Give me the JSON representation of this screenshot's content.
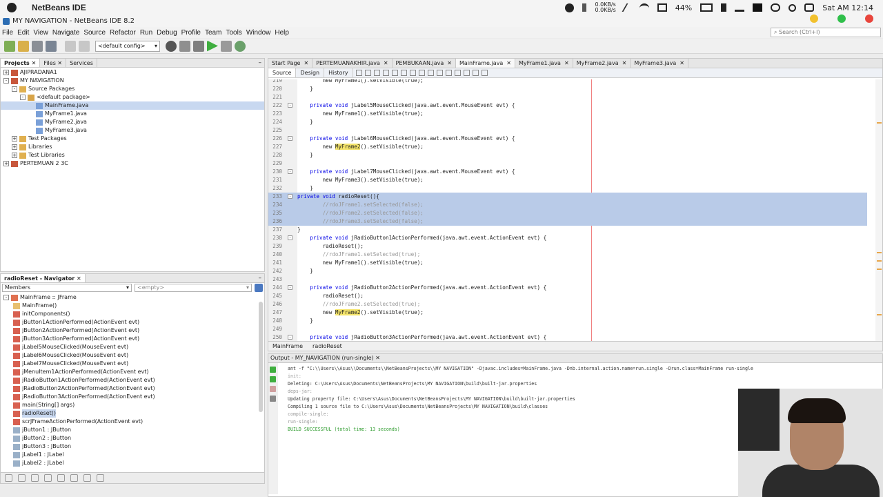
{
  "mac": {
    "app_name": "NetBeans IDE",
    "net_up": "0.0KB/s",
    "net_down": "0.0KB/s",
    "battery": "44%",
    "clock": "Sat AM 12:14"
  },
  "window": {
    "title": "MY NAVIGATION - NetBeans IDE 8.2"
  },
  "menu": [
    "File",
    "Edit",
    "View",
    "Navigate",
    "Source",
    "Refactor",
    "Run",
    "Debug",
    "Profile",
    "Team",
    "Tools",
    "Window",
    "Help"
  ],
  "search": {
    "placeholder": "Search (Ctrl+I)"
  },
  "toolbar": {
    "config": "<default config>"
  },
  "projects_panel": {
    "tabs": [
      "Projects",
      "Files",
      "Services"
    ],
    "tree": [
      {
        "label": "AJIPRADANA1",
        "indent": 0,
        "toggle": "+",
        "icon": "project"
      },
      {
        "label": "MY NAVIGATION",
        "indent": 0,
        "toggle": "-",
        "icon": "project"
      },
      {
        "label": "Source Packages",
        "indent": 1,
        "toggle": "-",
        "icon": "folder"
      },
      {
        "label": "<default package>",
        "indent": 2,
        "toggle": "-",
        "icon": "package"
      },
      {
        "label": "MainFrame.java",
        "indent": 3,
        "toggle": "",
        "icon": "file",
        "selected": true
      },
      {
        "label": "MyFrame1.java",
        "indent": 3,
        "toggle": "",
        "icon": "file"
      },
      {
        "label": "MyFrame2.java",
        "indent": 3,
        "toggle": "",
        "icon": "file"
      },
      {
        "label": "MyFrame3.java",
        "indent": 3,
        "toggle": "",
        "icon": "file"
      },
      {
        "label": "Test Packages",
        "indent": 1,
        "toggle": "+",
        "icon": "folder"
      },
      {
        "label": "Libraries",
        "indent": 1,
        "toggle": "+",
        "icon": "folder"
      },
      {
        "label": "Test Libraries",
        "indent": 1,
        "toggle": "+",
        "icon": "folder"
      },
      {
        "label": "PERTEMUAN 2 3C",
        "indent": 0,
        "toggle": "+",
        "icon": "project"
      }
    ]
  },
  "navigator": {
    "title": "radioReset - Navigator",
    "filter": "Members",
    "empty": "<empty>",
    "items": [
      {
        "label": "MainFrame :: JFrame",
        "indent": 0,
        "icon": "class"
      },
      {
        "label": "MainFrame()",
        "indent": 1,
        "icon": "ctor"
      },
      {
        "label": "initComponents()",
        "indent": 1,
        "icon": "method"
      },
      {
        "label": "jButton1ActionPerformed(ActionEvent evt)",
        "indent": 1,
        "icon": "method"
      },
      {
        "label": "jButton2ActionPerformed(ActionEvent evt)",
        "indent": 1,
        "icon": "method"
      },
      {
        "label": "jButton3ActionPerformed(ActionEvent evt)",
        "indent": 1,
        "icon": "method"
      },
      {
        "label": "jLabel5MouseClicked(MouseEvent evt)",
        "indent": 1,
        "icon": "method"
      },
      {
        "label": "jLabel6MouseClicked(MouseEvent evt)",
        "indent": 1,
        "icon": "method"
      },
      {
        "label": "jLabel7MouseClicked(MouseEvent evt)",
        "indent": 1,
        "icon": "method"
      },
      {
        "label": "jMenuItem1ActionPerformed(ActionEvent evt)",
        "indent": 1,
        "icon": "method"
      },
      {
        "label": "jRadioButton1ActionPerformed(ActionEvent evt)",
        "indent": 1,
        "icon": "method"
      },
      {
        "label": "jRadioButton2ActionPerformed(ActionEvent evt)",
        "indent": 1,
        "icon": "method"
      },
      {
        "label": "jRadioButton3ActionPerformed(ActionEvent evt)",
        "indent": 1,
        "icon": "method"
      },
      {
        "label": "main(String[] args)",
        "indent": 1,
        "icon": "method"
      },
      {
        "label": "radioReset()",
        "indent": 1,
        "icon": "method",
        "selected": true
      },
      {
        "label": "scrJFrameActionPerformed(ActionEvent evt)",
        "indent": 1,
        "icon": "method"
      },
      {
        "label": "jButton1 : JButton",
        "indent": 1,
        "icon": "field"
      },
      {
        "label": "jButton2 : JButton",
        "indent": 1,
        "icon": "field"
      },
      {
        "label": "jButton3 : JButton",
        "indent": 1,
        "icon": "field"
      },
      {
        "label": "jLabel1 : JLabel",
        "indent": 1,
        "icon": "field"
      },
      {
        "label": "jLabel2 : JLabel",
        "indent": 1,
        "icon": "field"
      }
    ]
  },
  "editor": {
    "tabs": [
      {
        "label": "Start Page",
        "active": false
      },
      {
        "label": "PERTEMUANAKHIR.java",
        "active": false
      },
      {
        "label": "PEMBUKAAN.java",
        "active": false
      },
      {
        "label": "MainFrame.java",
        "active": true
      },
      {
        "label": "MyFrame1.java",
        "active": false
      },
      {
        "label": "MyFrame2.java",
        "active": false
      },
      {
        "label": "MyFrame3.java",
        "active": false
      }
    ],
    "view_buttons": [
      "Source",
      "Design",
      "History"
    ],
    "breadcrumb": [
      "MainFrame",
      "radioReset"
    ],
    "lines": [
      {
        "n": "219",
        "t": "        new MyFrame1().setVisible(true);",
        "kind": "plain"
      },
      {
        "n": "220",
        "t": "    }",
        "kind": "plain"
      },
      {
        "n": "221",
        "t": "",
        "kind": "plain"
      },
      {
        "n": "222",
        "t": "    private void jLabel5MouseClicked(java.awt.event.MouseEvent evt) {",
        "kind": "method",
        "fold": "-"
      },
      {
        "n": "223",
        "t": "        new MyFrame1().setVisible(true);",
        "kind": "plain"
      },
      {
        "n": "224",
        "t": "    }",
        "kind": "plain"
      },
      {
        "n": "225",
        "t": "",
        "kind": "plain"
      },
      {
        "n": "226",
        "t": "    private void jLabel6MouseClicked(java.awt.event.MouseEvent evt) {",
        "kind": "method",
        "fold": "-"
      },
      {
        "n": "227",
        "t": "        new MyFrame2().setVisible(true);",
        "kind": "frame2"
      },
      {
        "n": "228",
        "t": "    }",
        "kind": "plain"
      },
      {
        "n": "229",
        "t": "",
        "kind": "plain"
      },
      {
        "n": "230",
        "t": "    private void jLabel7MouseClicked(java.awt.event.MouseEvent evt) {",
        "kind": "method",
        "fold": "-"
      },
      {
        "n": "231",
        "t": "        new MyFrame3().setVisible(true);",
        "kind": "plain"
      },
      {
        "n": "232",
        "t": "    }",
        "kind": "plain"
      },
      {
        "n": "233",
        "t": "private void radioReset(){",
        "kind": "method-sel",
        "fold": "-"
      },
      {
        "n": "234",
        "t": "        //rdoJFrame1.setSelected(false);",
        "kind": "comment-sel"
      },
      {
        "n": "235",
        "t": "        //rdoJFrame2.setSelected(false);",
        "kind": "comment-sel"
      },
      {
        "n": "236",
        "t": "        //rdoJFrame3.setSelected(false);",
        "kind": "comment-sel"
      },
      {
        "n": "237",
        "t": "}",
        "kind": "plain"
      },
      {
        "n": "238",
        "t": "    private void jRadioButton1ActionPerformed(java.awt.event.ActionEvent evt) {",
        "kind": "method",
        "fold": "-"
      },
      {
        "n": "239",
        "t": "        radioReset();",
        "kind": "plain"
      },
      {
        "n": "240",
        "t": "        //rdoJFrame1.setSelected(true);",
        "kind": "comment"
      },
      {
        "n": "241",
        "t": "        new MyFrame1().setVisible(true);",
        "kind": "plain"
      },
      {
        "n": "242",
        "t": "    }",
        "kind": "plain"
      },
      {
        "n": "243",
        "t": "",
        "kind": "plain"
      },
      {
        "n": "244",
        "t": "    private void jRadioButton2ActionPerformed(java.awt.event.ActionEvent evt) {",
        "kind": "method",
        "fold": "-"
      },
      {
        "n": "245",
        "t": "        radioReset();",
        "kind": "plain"
      },
      {
        "n": "246",
        "t": "        //rdoJFrame2.setSelected(true);",
        "kind": "comment"
      },
      {
        "n": "247",
        "t": "        new MyFrame2().setVisible(true);",
        "kind": "frame2"
      },
      {
        "n": "248",
        "t": "    }",
        "kind": "plain"
      },
      {
        "n": "249",
        "t": "",
        "kind": "plain"
      },
      {
        "n": "250",
        "t": "    private void jRadioButton3ActionPerformed(java.awt.event.ActionEvent evt) {",
        "kind": "method",
        "fold": "-"
      }
    ]
  },
  "output": {
    "title": "Output - MY_NAVIGATION (run-single)",
    "lines": [
      {
        "t": "ant -f \"C:\\\\Users\\\\Asus\\\\Documents\\\\NetBeansProjects\\\\MY NAVIGATION\" -Djavac.includes=MainFrame.java -Dnb.internal.action.name=run.single -Drun.class=MainFrame run-single",
        "kind": "normal"
      },
      {
        "t": "init:",
        "kind": "grey"
      },
      {
        "t": "Deleting: C:\\Users\\Asus\\Documents\\NetBeansProjects\\MY NAVIGATION\\build\\built-jar.properties",
        "kind": "normal"
      },
      {
        "t": "deps-jar:",
        "kind": "grey"
      },
      {
        "t": "Updating property file: C:\\Users\\Asus\\Documents\\NetBeansProjects\\MY NAVIGATION\\build\\built-jar.properties",
        "kind": "normal"
      },
      {
        "t": "Compiling 1 source file to C:\\Users\\Asus\\Documents\\NetBeansProjects\\MY NAVIGATION\\build\\classes",
        "kind": "normal"
      },
      {
        "t": "compile-single:",
        "kind": "grey"
      },
      {
        "t": "run-single:",
        "kind": "grey"
      },
      {
        "t": "BUILD SUCCESSFUL (total time: 13 seconds)",
        "kind": "green"
      }
    ]
  }
}
